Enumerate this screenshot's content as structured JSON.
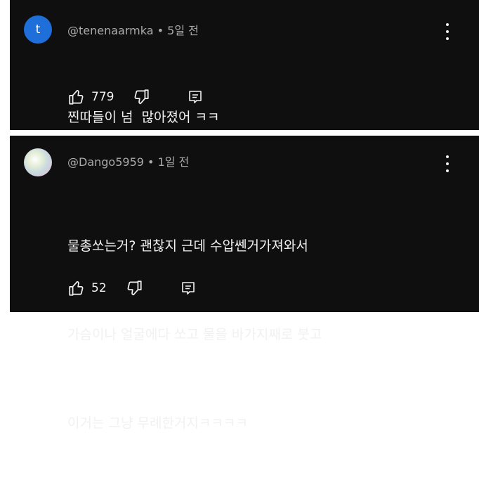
{
  "comments": [
    {
      "avatar_letter": "t",
      "avatar_color": "#1e6fd9",
      "meta": "@tenenaarmka • 5일 전",
      "text_lines": [
        "찐따들이 넘  많아졌어 ㅋㅋ"
      ],
      "likes": "779",
      "icons": {
        "like": "thumbs-up-icon",
        "dislike": "thumbs-down-icon",
        "reply": "reply-comment-icon",
        "menu": "more-vertical-icon"
      }
    },
    {
      "meta": "@Dango5959 • 1일 전",
      "text_lines": [
        "물총쏘는거? 괜찮지 근데 수압쎈거가져와서",
        "가슴이나 얼굴에다 쏘고 물을 바가지째로 붓고",
        "이거는 그냥 무례한거지ㅋㅋㅋㅋ"
      ],
      "likes": "52",
      "icons": {
        "like": "thumbs-up-icon",
        "dislike": "thumbs-down-icon",
        "reply": "reply-comment-icon",
        "menu": "more-vertical-icon"
      }
    }
  ],
  "colors": {
    "background": "#0f0f0f",
    "text": "#f1f1f1",
    "secondary_text": "#aaaaaa"
  }
}
